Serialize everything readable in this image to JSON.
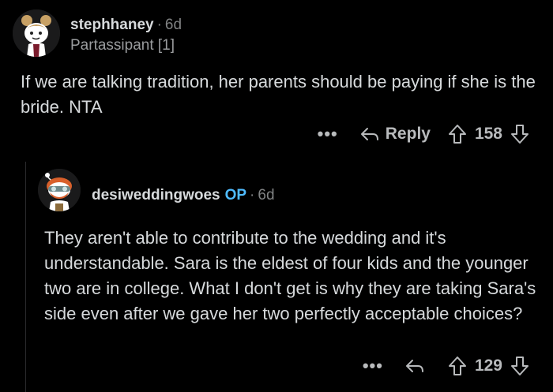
{
  "comment": {
    "username": "stephhaney",
    "age": "6d",
    "flair": "Partassipant [1]",
    "body": "If we are talking tradition, her parents should be paying if she is the bride. NTA",
    "more_label": "•••",
    "reply_label": "Reply",
    "score": "158"
  },
  "reply": {
    "username": "desiweddingwoes",
    "op_badge": "OP",
    "age": "6d",
    "body": "They aren't able to contribute to the wedding and it's understandable. Sara is the eldest of four kids and the younger two are in college. What I don't get is why they are taking Sara's side even after we gave her two perfectly acceptable choices?",
    "more_label": "•••",
    "score": "129"
  },
  "icons": {
    "reply": "reply-arrow-icon",
    "upvote": "upvote-arrow-icon",
    "downvote": "downvote-arrow-icon"
  },
  "colors": {
    "background": "#000000",
    "text": "#d7dadc",
    "muted": "#818384",
    "op_badge": "#4fbcff"
  }
}
